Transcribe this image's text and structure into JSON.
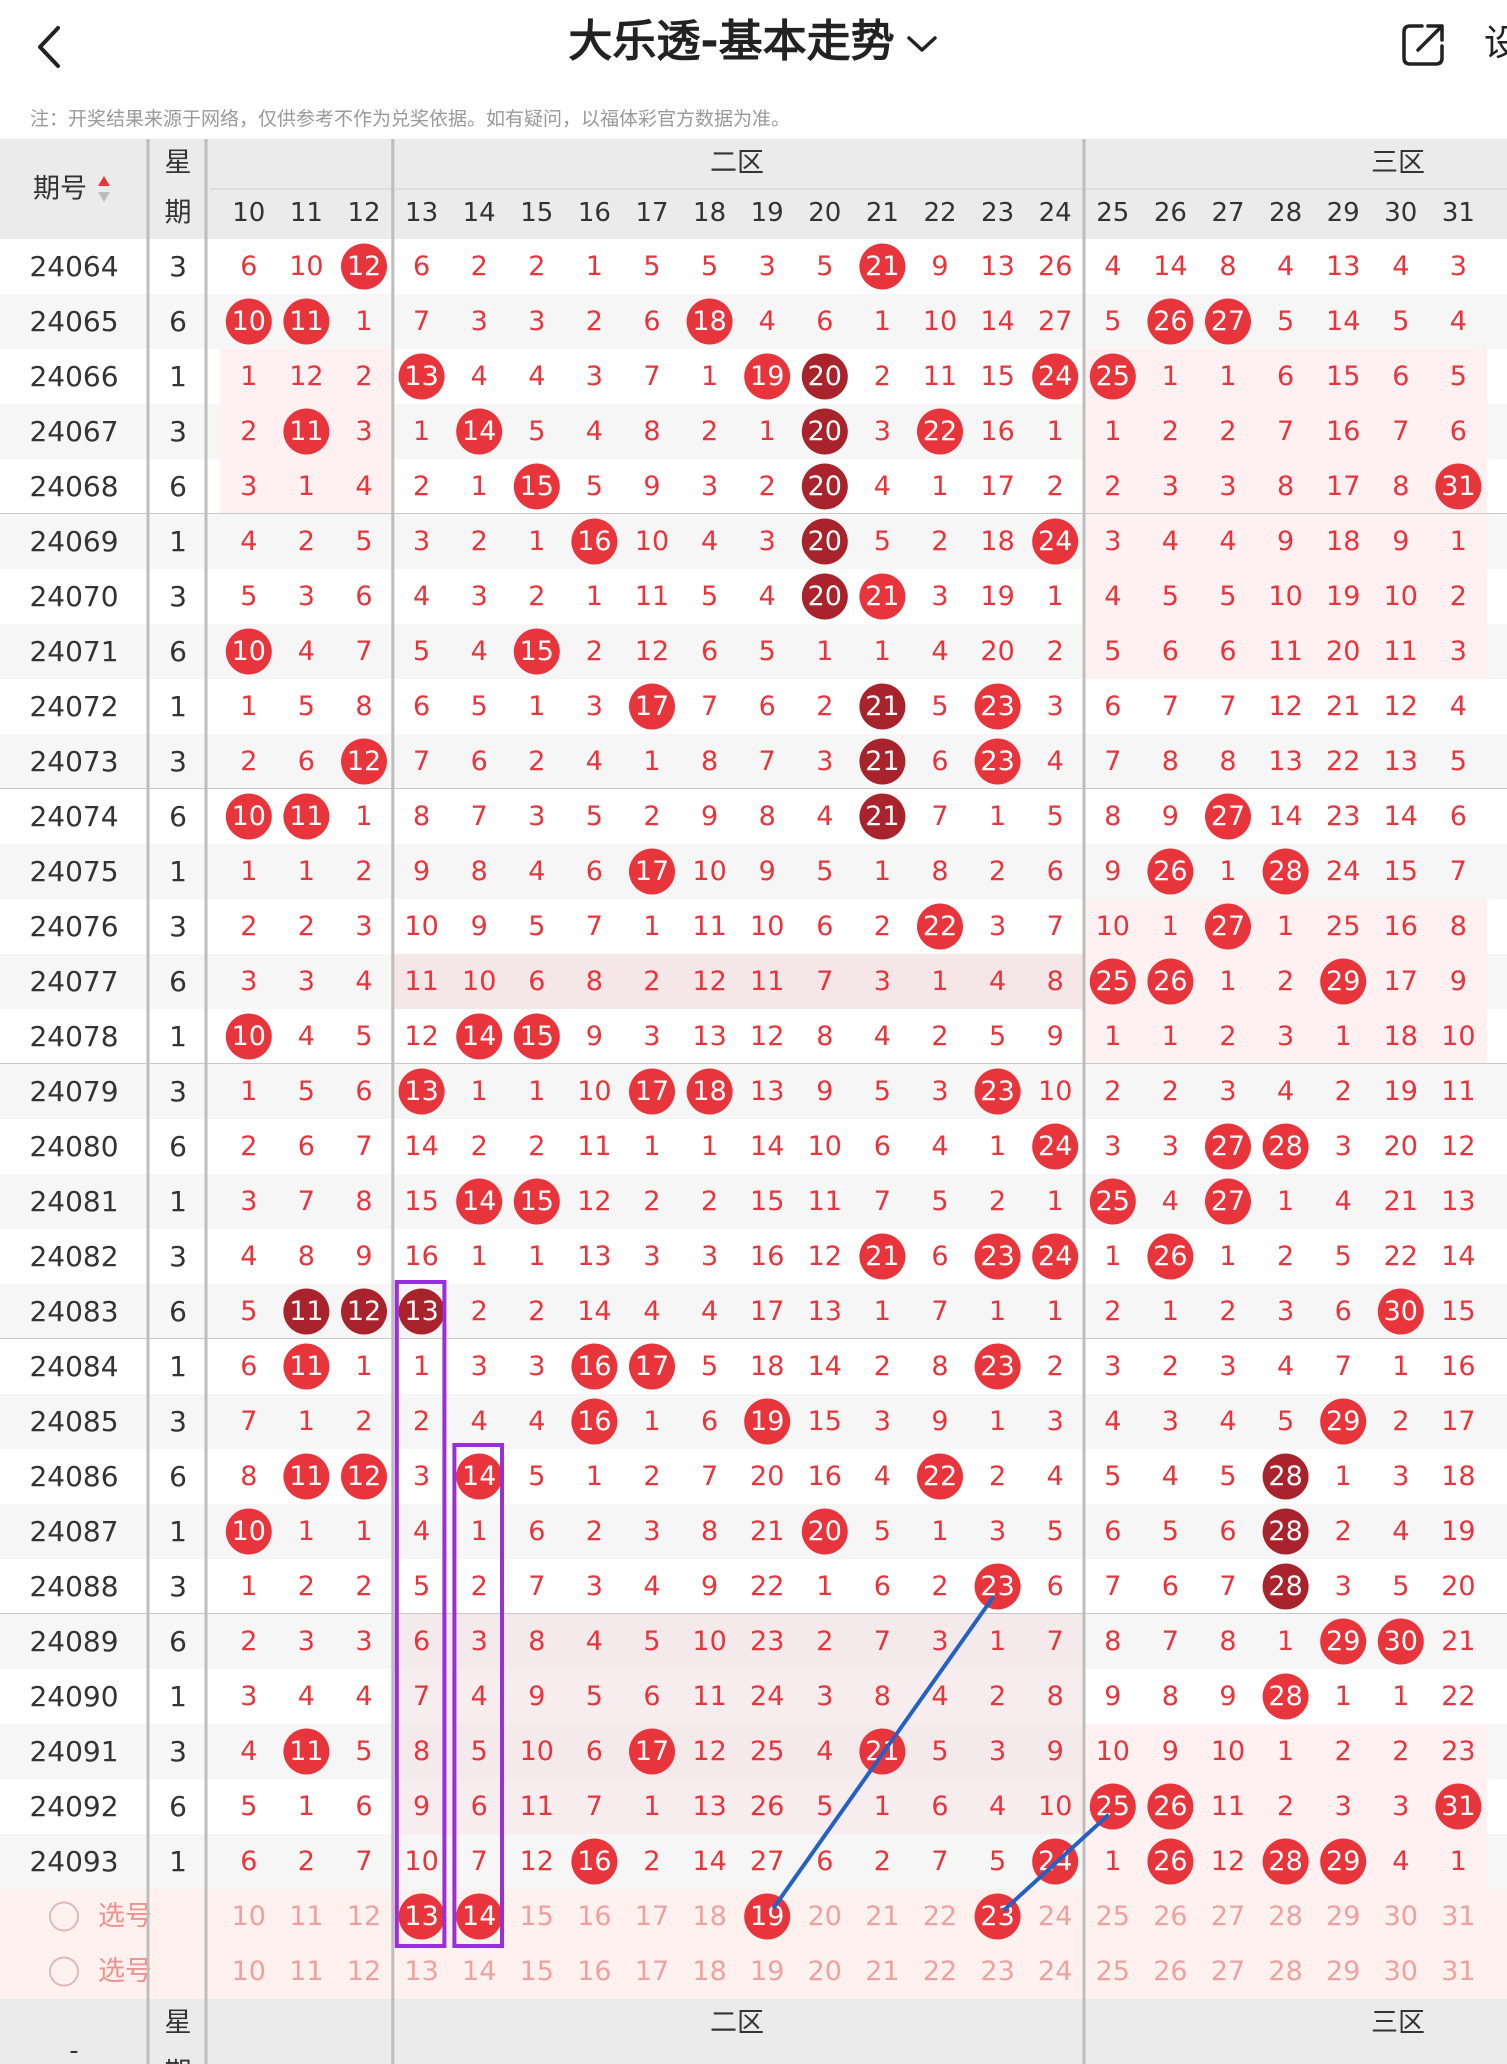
{
  "header": {
    "title": "大乐透-基本走势",
    "back_icon": "chevron-left-icon",
    "title_dropdown_icon": "chevron-down-icon",
    "share_icon": "share-icon",
    "settings_label": "设"
  },
  "note": "注：开奖结果来源于网络，仅供参考不作为兑奖依据。如有疑问，以福体彩官方数据为准。",
  "table": {
    "col_issue": "期号",
    "col_week_top": "星",
    "col_week_bottom": "期",
    "zone2": "二区",
    "zone3": "三区",
    "cols": [
      10,
      11,
      12,
      13,
      14,
      15,
      16,
      17,
      18,
      19,
      20,
      21,
      22,
      23,
      24,
      25,
      26,
      27,
      28,
      29,
      30,
      31
    ],
    "rows": [
      {
        "issue": "24064",
        "week": "3",
        "cells": [
          6,
          10,
          12,
          6,
          2,
          2,
          1,
          5,
          5,
          3,
          5,
          21,
          9,
          13,
          26,
          4,
          14,
          8,
          4,
          13,
          4,
          3
        ]
      },
      {
        "issue": "24065",
        "week": "6",
        "cells": [
          10,
          11,
          1,
          7,
          3,
          3,
          2,
          6,
          18,
          4,
          6,
          1,
          10,
          14,
          27,
          5,
          26,
          27,
          5,
          14,
          5,
          4
        ]
      },
      {
        "issue": "24066",
        "week": "1",
        "cells": [
          1,
          12,
          2,
          13,
          4,
          4,
          3,
          7,
          1,
          19,
          20,
          2,
          11,
          15,
          24,
          25,
          1,
          1,
          6,
          15,
          6,
          5
        ]
      },
      {
        "issue": "24067",
        "week": "3",
        "cells": [
          2,
          11,
          3,
          1,
          14,
          5,
          4,
          8,
          2,
          1,
          20,
          3,
          22,
          16,
          1,
          1,
          2,
          2,
          7,
          16,
          7,
          6
        ]
      },
      {
        "issue": "24068",
        "week": "6",
        "cells": [
          3,
          1,
          4,
          2,
          1,
          15,
          5,
          9,
          3,
          2,
          20,
          4,
          1,
          17,
          2,
          2,
          3,
          3,
          8,
          17,
          8,
          31
        ]
      },
      {
        "issue": "24069",
        "week": "1",
        "cells": [
          4,
          2,
          5,
          3,
          2,
          1,
          16,
          10,
          4,
          3,
          20,
          5,
          2,
          18,
          24,
          3,
          4,
          4,
          9,
          18,
          9,
          1
        ]
      },
      {
        "issue": "24070",
        "week": "3",
        "cells": [
          5,
          3,
          6,
          4,
          3,
          2,
          1,
          11,
          5,
          4,
          20,
          21,
          3,
          19,
          1,
          4,
          5,
          5,
          10,
          19,
          10,
          2
        ]
      },
      {
        "issue": "24071",
        "week": "6",
        "cells": [
          10,
          4,
          7,
          5,
          4,
          15,
          2,
          12,
          6,
          5,
          1,
          1,
          4,
          20,
          2,
          5,
          6,
          6,
          11,
          20,
          11,
          3
        ]
      },
      {
        "issue": "24072",
        "week": "1",
        "cells": [
          1,
          5,
          8,
          6,
          5,
          1,
          3,
          17,
          7,
          6,
          2,
          21,
          5,
          23,
          3,
          6,
          7,
          7,
          12,
          21,
          12,
          4
        ]
      },
      {
        "issue": "24073",
        "week": "3",
        "cells": [
          2,
          6,
          12,
          7,
          6,
          2,
          4,
          1,
          8,
          7,
          3,
          21,
          6,
          23,
          4,
          7,
          8,
          8,
          13,
          22,
          13,
          5
        ]
      },
      {
        "issue": "24074",
        "week": "6",
        "cells": [
          10,
          11,
          1,
          8,
          7,
          3,
          5,
          2,
          9,
          8,
          4,
          21,
          7,
          1,
          5,
          8,
          9,
          27,
          14,
          23,
          14,
          6
        ]
      },
      {
        "issue": "24075",
        "week": "1",
        "cells": [
          1,
          1,
          2,
          9,
          8,
          4,
          6,
          17,
          10,
          9,
          5,
          1,
          8,
          2,
          6,
          9,
          26,
          1,
          28,
          24,
          15,
          7
        ]
      },
      {
        "issue": "24076",
        "week": "3",
        "cells": [
          2,
          2,
          3,
          10,
          9,
          5,
          7,
          1,
          11,
          10,
          6,
          2,
          22,
          3,
          7,
          10,
          1,
          27,
          1,
          25,
          16,
          8
        ]
      },
      {
        "issue": "24077",
        "week": "6",
        "cells": [
          3,
          3,
          4,
          11,
          10,
          6,
          8,
          2,
          12,
          11,
          7,
          3,
          1,
          4,
          8,
          25,
          26,
          1,
          2,
          29,
          17,
          9
        ]
      },
      {
        "issue": "24078",
        "week": "1",
        "cells": [
          10,
          4,
          5,
          12,
          14,
          15,
          9,
          3,
          13,
          12,
          8,
          4,
          2,
          5,
          9,
          1,
          1,
          2,
          3,
          1,
          18,
          10
        ]
      },
      {
        "issue": "24079",
        "week": "3",
        "cells": [
          1,
          5,
          6,
          13,
          1,
          1,
          10,
          17,
          18,
          13,
          9,
          5,
          3,
          23,
          10,
          2,
          2,
          3,
          4,
          2,
          19,
          11
        ]
      },
      {
        "issue": "24080",
        "week": "6",
        "cells": [
          2,
          6,
          7,
          14,
          2,
          2,
          11,
          1,
          1,
          14,
          10,
          6,
          4,
          1,
          24,
          3,
          3,
          27,
          28,
          3,
          20,
          12
        ]
      },
      {
        "issue": "24081",
        "week": "1",
        "cells": [
          3,
          7,
          8,
          15,
          14,
          15,
          12,
          2,
          2,
          15,
          11,
          7,
          5,
          2,
          1,
          25,
          4,
          27,
          1,
          4,
          21,
          13
        ]
      },
      {
        "issue": "24082",
        "week": "3",
        "cells": [
          4,
          8,
          9,
          16,
          1,
          1,
          13,
          3,
          3,
          16,
          12,
          21,
          6,
          23,
          24,
          1,
          26,
          1,
          2,
          5,
          22,
          14
        ]
      },
      {
        "issue": "24083",
        "week": "6",
        "cells": [
          5,
          11,
          12,
          13,
          2,
          2,
          14,
          4,
          4,
          17,
          13,
          1,
          7,
          1,
          1,
          2,
          1,
          2,
          3,
          6,
          30,
          15
        ]
      },
      {
        "issue": "24084",
        "week": "1",
        "cells": [
          6,
          11,
          1,
          1,
          3,
          3,
          16,
          17,
          5,
          18,
          14,
          2,
          8,
          23,
          2,
          3,
          2,
          3,
          4,
          7,
          1,
          16
        ]
      },
      {
        "issue": "24085",
        "week": "3",
        "cells": [
          7,
          1,
          2,
          2,
          4,
          4,
          16,
          1,
          6,
          19,
          15,
          3,
          9,
          1,
          3,
          4,
          3,
          4,
          5,
          29,
          2,
          17
        ]
      },
      {
        "issue": "24086",
        "week": "6",
        "cells": [
          8,
          11,
          12,
          3,
          14,
          5,
          1,
          2,
          7,
          20,
          16,
          4,
          22,
          2,
          4,
          5,
          4,
          5,
          28,
          1,
          3,
          18
        ]
      },
      {
        "issue": "24087",
        "week": "1",
        "cells": [
          10,
          1,
          1,
          4,
          1,
          6,
          2,
          3,
          8,
          21,
          20,
          5,
          1,
          3,
          5,
          6,
          5,
          6,
          28,
          2,
          4,
          19
        ]
      },
      {
        "issue": "24088",
        "week": "3",
        "cells": [
          1,
          2,
          2,
          5,
          2,
          7,
          3,
          4,
          9,
          22,
          1,
          6,
          2,
          23,
          6,
          7,
          6,
          7,
          28,
          3,
          5,
          20
        ]
      },
      {
        "issue": "24089",
        "week": "6",
        "cells": [
          2,
          3,
          3,
          6,
          3,
          8,
          4,
          5,
          10,
          23,
          2,
          7,
          3,
          1,
          7,
          8,
          7,
          8,
          1,
          29,
          30,
          21
        ]
      },
      {
        "issue": "24090",
        "week": "1",
        "cells": [
          3,
          4,
          4,
          7,
          4,
          9,
          5,
          6,
          11,
          24,
          3,
          8,
          4,
          2,
          8,
          9,
          8,
          9,
          28,
          1,
          1,
          22
        ]
      },
      {
        "issue": "24091",
        "week": "3",
        "cells": [
          4,
          11,
          5,
          8,
          5,
          10,
          6,
          17,
          12,
          25,
          4,
          21,
          5,
          3,
          9,
          10,
          9,
          10,
          1,
          2,
          2,
          23
        ]
      },
      {
        "issue": "24092",
        "week": "6",
        "cells": [
          5,
          1,
          6,
          9,
          6,
          11,
          7,
          1,
          13,
          26,
          5,
          1,
          6,
          4,
          10,
          25,
          26,
          11,
          2,
          3,
          3,
          31
        ]
      },
      {
        "issue": "24093",
        "week": "1",
        "cells": [
          6,
          2,
          7,
          10,
          7,
          12,
          16,
          2,
          14,
          27,
          6,
          2,
          7,
          5,
          24,
          1,
          26,
          12,
          28,
          29,
          4,
          1
        ]
      }
    ],
    "select_rows": [
      {
        "label": "选号",
        "radio_icon": "radio-circle-icon"
      },
      {
        "label": "选号",
        "radio_icon": "radio-circle-icon"
      }
    ],
    "select_row1_selected": [
      13,
      14,
      19,
      23
    ],
    "sort_icon": "sort-arrows-icon",
    "footer_week_top": "星",
    "footer_week_bottom": "期",
    "footer_issue": "-"
  },
  "colors": {
    "red": "#e8343b",
    "dark_red": "#a8232b",
    "purple_box": "#9a2fd6",
    "blue_line": "#2361c4",
    "header_bg": "#ebebeb",
    "row_pink": "#fff1f1",
    "shade": "#f5e6e7",
    "select_bg": "#fff2ee"
  }
}
